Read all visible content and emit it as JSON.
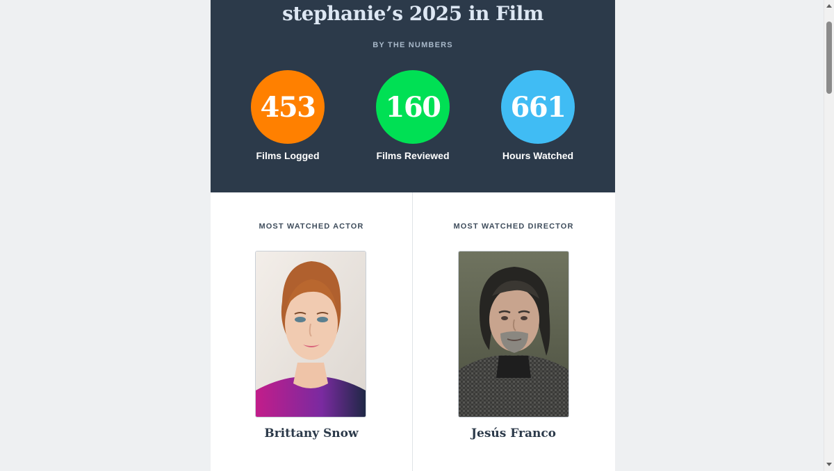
{
  "header": {
    "title": "stephanie’s 2025 in Film",
    "subtitle": "BY THE NUMBERS"
  },
  "stats": [
    {
      "value": "453",
      "label": "Films Logged",
      "color": "#ff8000"
    },
    {
      "value": "160",
      "label": "Films Reviewed",
      "color": "#00e054"
    },
    {
      "value": "661",
      "label": "Hours Watched",
      "color": "#40bcf4"
    }
  ],
  "most_watched": {
    "actor": {
      "heading": "MOST WATCHED ACTOR",
      "name": "Brittany Snow"
    },
    "director": {
      "heading": "MOST WATCHED DIRECTOR",
      "name": "Jesús Franco"
    }
  },
  "colors": {
    "hero_background": "#2c3a4a",
    "page_background": "#eef0f2"
  }
}
